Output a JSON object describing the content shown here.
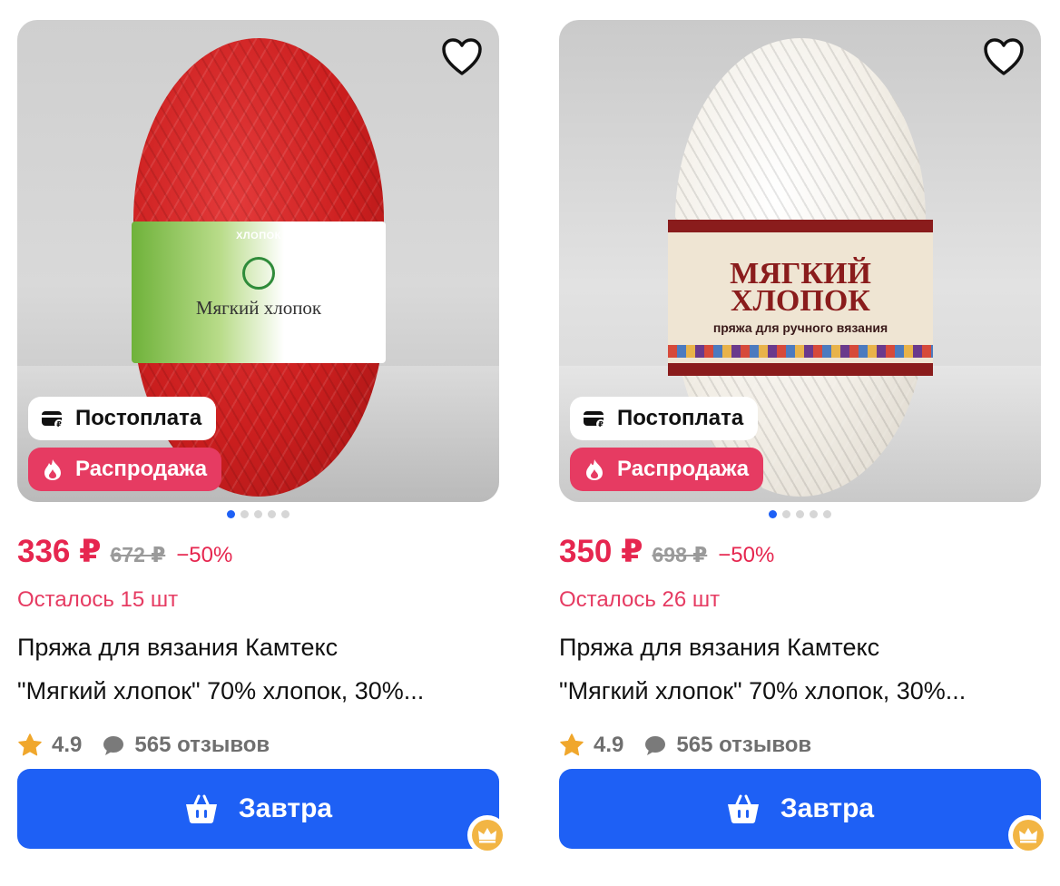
{
  "products": [
    {
      "variant": "red",
      "price": "336 ₽",
      "old_price": "672 ₽",
      "discount": "−50%",
      "stock": "Осталось 15 шт",
      "title_line1": "Пряжа для вязания Камтекс",
      "title_line2": "\"Мягкий хлопок\" 70% хлопок, 30%...",
      "rating": "4.9",
      "reviews": "565 отзывов",
      "badge_payment": "Постоплата",
      "badge_sale": "Распродажа",
      "buy_label": "Завтра",
      "label_top": "ХЛОПОК",
      "label_name": "Мягкий хлопок",
      "gallery": {
        "count": 5,
        "active": 0
      }
    },
    {
      "variant": "white",
      "price": "350 ₽",
      "old_price": "698 ₽",
      "discount": "−50%",
      "stock": "Осталось 26 шт",
      "title_line1": "Пряжа для вязания Камтекс",
      "title_line2": "\"Мягкий хлопок\" 70% хлопок, 30%...",
      "rating": "4.9",
      "reviews": "565 отзывов",
      "badge_payment": "Постоплата",
      "badge_sale": "Распродажа",
      "buy_label": "Завтра",
      "label_big": "МЯГКИЙ ХЛОПОК",
      "label_sub": "пряжа для ручного вязания",
      "gallery": {
        "count": 5,
        "active": 0
      }
    }
  ],
  "icons": {
    "favorite": "heart-icon",
    "payment": "wallet-icon",
    "sale": "flame-icon",
    "rating": "star-icon",
    "reviews": "chat-bubble-icon",
    "cart": "basket-icon",
    "premium": "crown-icon"
  },
  "colors": {
    "accent_blue": "#1e60f5",
    "sale_pink": "#e63b62",
    "price_red": "#e6264f",
    "star": "#f0a72c",
    "crown": "#f2b544"
  }
}
